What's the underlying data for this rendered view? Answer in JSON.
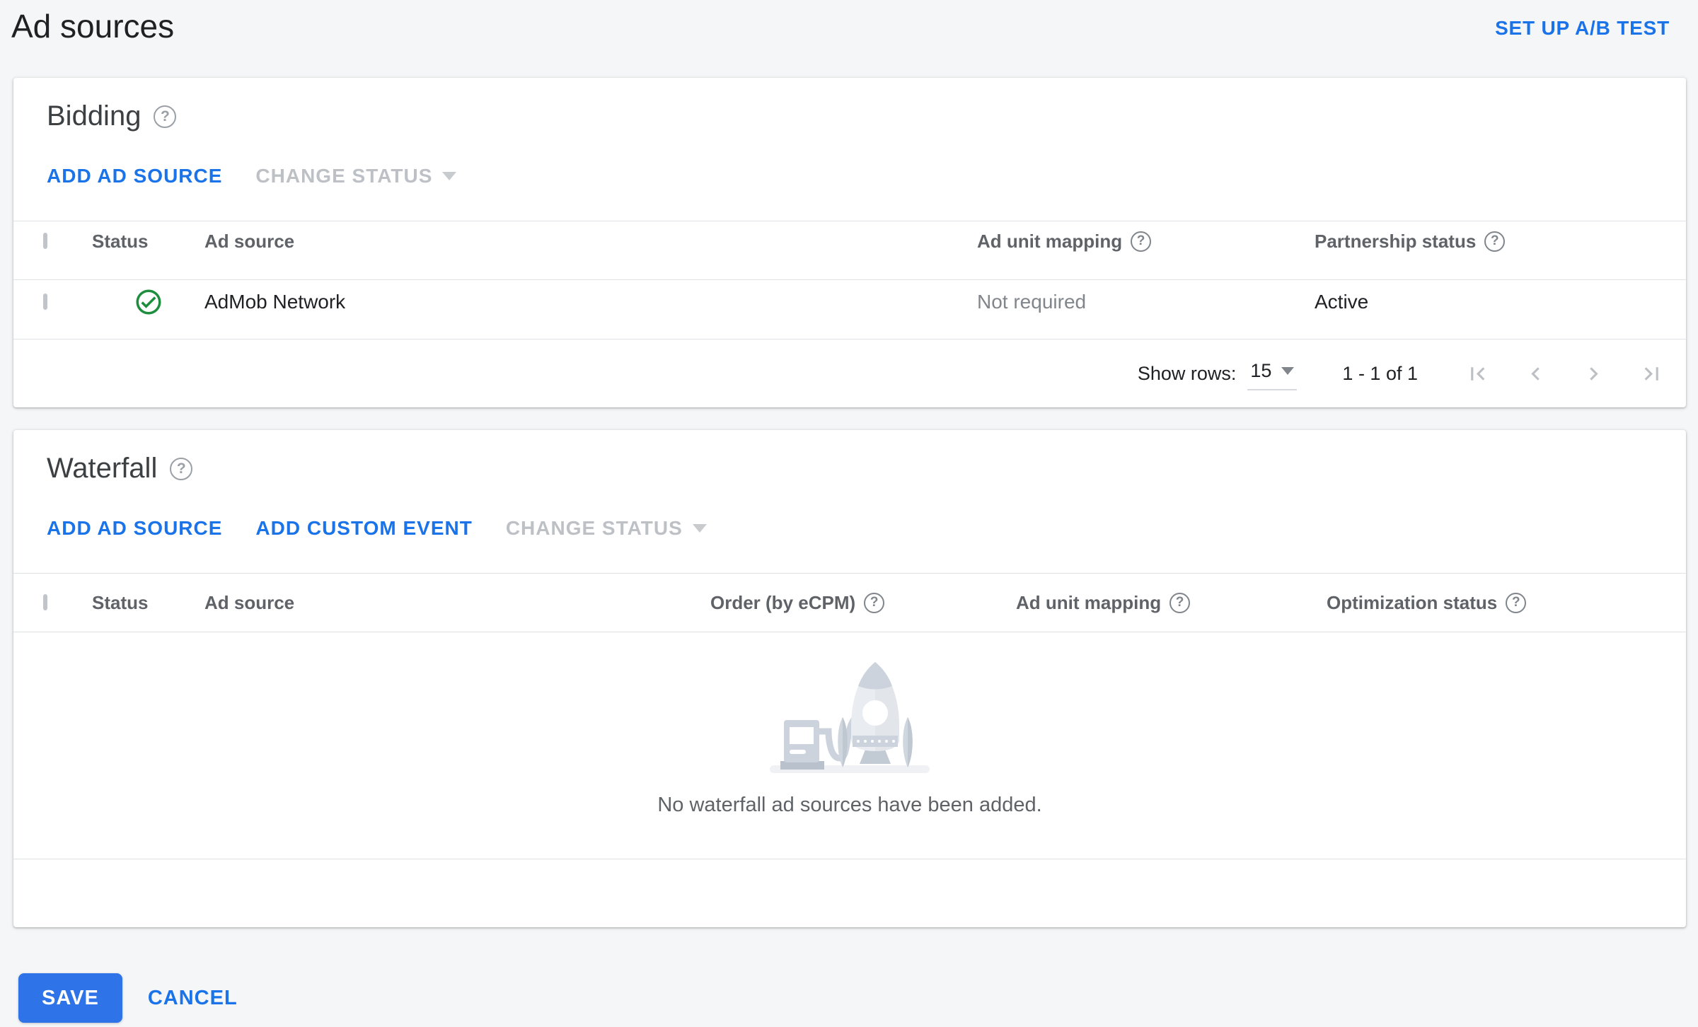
{
  "page": {
    "title": "Ad sources",
    "ab_test_label": "SET UP A/B TEST"
  },
  "icons": {
    "help_glyph": "?"
  },
  "bidding": {
    "title": "Bidding",
    "actions": {
      "add_ad_source": "ADD AD SOURCE",
      "change_status": "CHANGE STATUS"
    },
    "columns": {
      "status": "Status",
      "ad_source": "Ad source",
      "ad_unit_mapping": "Ad unit mapping",
      "partnership_status": "Partnership status"
    },
    "rows": [
      {
        "status_icon": "check-circle-green",
        "ad_source": "AdMob Network",
        "ad_unit_mapping": "Not required",
        "partnership_status": "Active"
      }
    ],
    "pagination": {
      "show_rows_label": "Show rows:",
      "rows_per_page": "15",
      "range": "1 - 1 of 1"
    }
  },
  "waterfall": {
    "title": "Waterfall",
    "actions": {
      "add_ad_source": "ADD AD SOURCE",
      "add_custom_event": "ADD CUSTOM EVENT",
      "change_status": "CHANGE STATUS"
    },
    "columns": {
      "status": "Status",
      "ad_source": "Ad source",
      "order": "Order (by eCPM)",
      "ad_unit_mapping": "Ad unit mapping",
      "optimization_status": "Optimization status"
    },
    "empty_message": "No waterfall ad sources have been added."
  },
  "footer": {
    "save": "SAVE",
    "cancel": "CANCEL"
  },
  "colors": {
    "accent_blue": "#1a73e8",
    "success_green": "#1e8e3e",
    "disabled_gray": "#bdc1c6"
  }
}
